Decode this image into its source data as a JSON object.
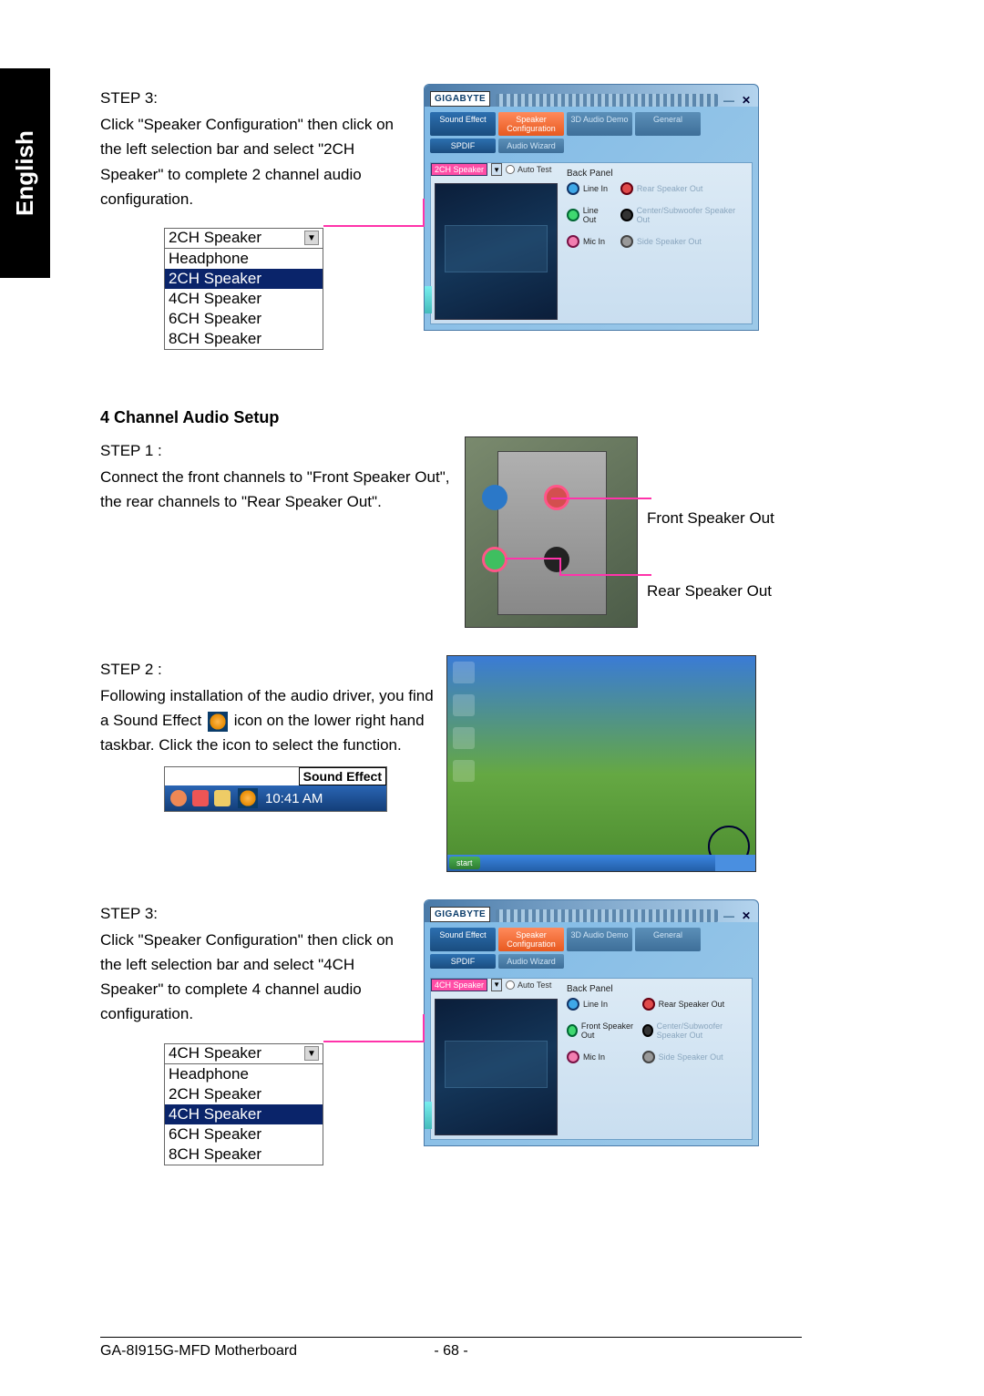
{
  "language_tab": "English",
  "footer": {
    "model": "GA-8I915G-MFD Motherboard",
    "page": "- 68 -"
  },
  "section2ch": {
    "step_label": "STEP 3:",
    "body": "Click \"Speaker Configuration\" then click on the left selection bar and select \"2CH Speaker\" to complete 2 channel audio configuration.",
    "dropdown_selected": "2CH Speaker",
    "dropdown_options": [
      "Headphone",
      "2CH Speaker",
      "4CH Speaker",
      "6CH Speaker",
      "8CH Speaker"
    ],
    "dropdown_highlight": "2CH Speaker",
    "window": {
      "logo": "GIGABYTE",
      "tabs": [
        "Sound Effect",
        "Speaker Configuration",
        "3D Audio Demo",
        "General",
        "SPDIF",
        "Audio Wizard"
      ],
      "selector": "2CH Speaker",
      "autotest": "Auto Test",
      "backpanel_title": "Back Panel",
      "left_jacks": [
        {
          "color": "blue",
          "label": "Line In"
        },
        {
          "color": "green",
          "label": "Line Out"
        },
        {
          "color": "pink",
          "label": "Mic In"
        }
      ],
      "right_jacks": [
        {
          "color": "red",
          "label": "Rear Speaker Out",
          "dim": true
        },
        {
          "color": "black",
          "label": "Center/Subwoofer Speaker Out",
          "dim": true
        },
        {
          "color": "grey",
          "label": "Side Speaker Out",
          "dim": true
        }
      ]
    }
  },
  "section4ch": {
    "title": "4 Channel Audio Setup",
    "step1_label": "STEP 1 :",
    "step1_body": "Connect the front channels to \"Front Speaker Out\", the rear channels to \"Rear Speaker Out\".",
    "hw_labels": [
      "Front Speaker Out",
      "Rear Speaker Out"
    ],
    "step2_label": "STEP 2 :",
    "step2_body_before": "Following installation of the audio driver, you find a Sound Effect",
    "step2_body_after": "icon on the lower right hand taskbar. Click the icon to select the function.",
    "taskbar_tooltip": "Sound Effect",
    "taskbar_time": "10:41 AM",
    "desktop_start": "start",
    "step3_label": "STEP 3:",
    "step3_body": "Click \"Speaker Configuration\" then click on the left selection bar and select \"4CH Speaker\" to complete 4 channel audio configuration.",
    "dropdown_selected": "4CH Speaker",
    "dropdown_options": [
      "Headphone",
      "2CH Speaker",
      "4CH Speaker",
      "6CH Speaker",
      "8CH Speaker"
    ],
    "dropdown_highlight": "4CH Speaker",
    "window": {
      "logo": "GIGABYTE",
      "tabs": [
        "Sound Effect",
        "Speaker Configuration",
        "3D Audio Demo",
        "General",
        "SPDIF",
        "Audio Wizard"
      ],
      "selector": "4CH Speaker",
      "autotest": "Auto Test",
      "backpanel_title": "Back Panel",
      "left_jacks": [
        {
          "color": "blue",
          "label": "Line In"
        },
        {
          "color": "green",
          "label": "Front Speaker Out"
        },
        {
          "color": "pink",
          "label": "Mic In"
        }
      ],
      "right_jacks": [
        {
          "color": "red",
          "label": "Rear Speaker Out",
          "dim": false
        },
        {
          "color": "black",
          "label": "Center/Subwoofer Speaker Out",
          "dim": true
        },
        {
          "color": "grey",
          "label": "Side Speaker Out",
          "dim": true
        }
      ]
    }
  }
}
